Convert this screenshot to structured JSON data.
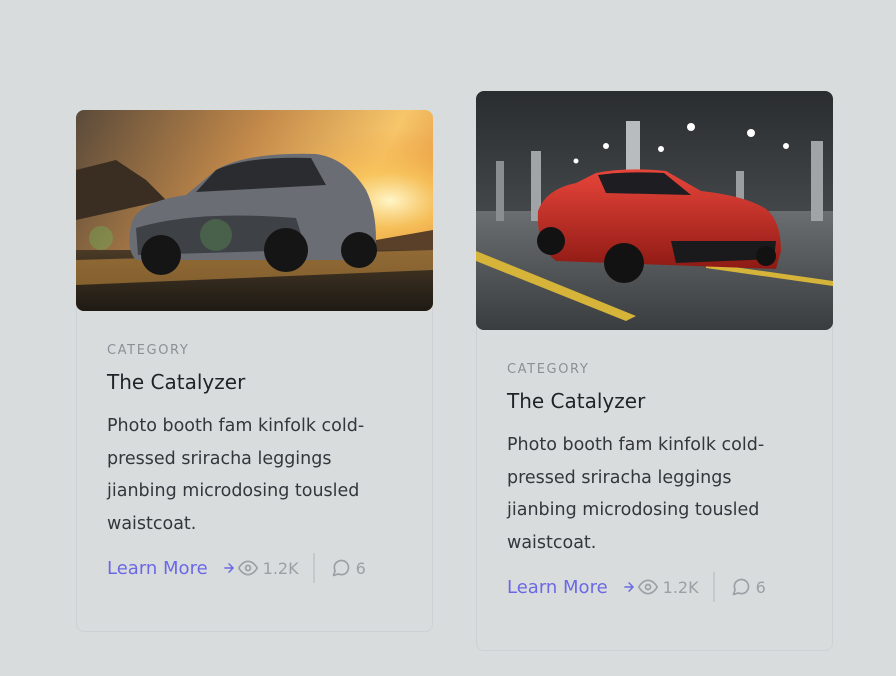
{
  "cards": [
    {
      "category": "CATEGORY",
      "title": "The Catalyzer",
      "description": "Photo booth fam kinfolk cold-pressed sriracha leggings jianbing microdosing tousled waistcoat.",
      "link_label": "Learn More",
      "views": "1.2K",
      "comments": "6",
      "image": "sunset-car-photo"
    },
    {
      "category": "CATEGORY",
      "title": "The Catalyzer",
      "description": "Photo booth fam kinfolk cold-pressed sriracha leggings jianbing microdosing tousled waistcoat.",
      "link_label": "Learn More",
      "views": "1.2K",
      "comments": "6",
      "image": "red-sports-car-garage-photo"
    }
  ],
  "colors": {
    "background": "#d9dcdc",
    "accent": "#6b68e6",
    "muted": "#9aa0a6"
  }
}
